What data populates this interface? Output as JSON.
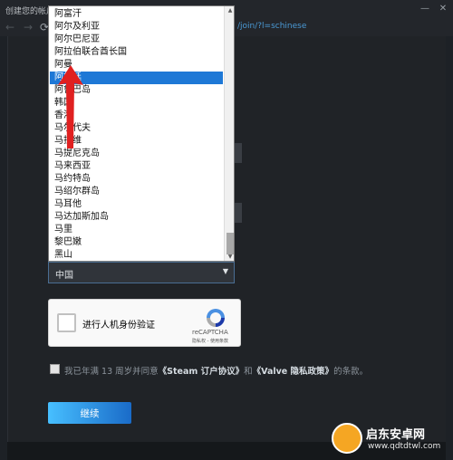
{
  "window": {
    "title": "创建您的帐户",
    "controls": [
      "minimize-icon",
      "close-icon"
    ]
  },
  "nav": {
    "back_icon": "arrow-left-icon",
    "forward_icon": "arrow-right-icon",
    "reload_icon": "reload-icon",
    "url": "/join/?l=schinese"
  },
  "country_dropdown": {
    "items": [
      "阿富汗",
      "阿尔及利亚",
      "阿尔巴尼亚",
      "阿拉伯联合酋长国",
      "阿曼",
      "阿根廷",
      "阿鲁巴岛",
      "韩国",
      "香港",
      "马尔代夫",
      "马拉维",
      "马提尼克岛",
      "马来西亚",
      "马约特岛",
      "马绍尔群岛",
      "马耳他",
      "马达加斯加岛",
      "马里",
      "黎巴嫩",
      "黑山"
    ],
    "highlighted": "阿根廷",
    "selected": "中国",
    "caret_icon": "chevron-down-icon"
  },
  "captcha": {
    "label": "进行人机身份验证",
    "brand": "reCAPTCHA",
    "links": "隐私权 - 使用条款",
    "logo_icon": "recaptcha-logo-icon"
  },
  "agreement": {
    "prefix": "我已年满 13 周岁并同意",
    "link1": "《Steam 订户协议》",
    "middle": "和",
    "link2": "《Valve 隐私政策》",
    "suffix": "的条款。"
  },
  "continue_button": "继续",
  "watermark": {
    "title": "启东安卓网",
    "url": "www.qdtdtwl.com",
    "logo_icon": "watermark-logo-icon"
  },
  "annotation": {
    "icon": "red-arrow-icon",
    "color": "#e02020"
  },
  "colors": {
    "highlight": "#1e78d6",
    "button_start": "#47bfff",
    "button_end": "#1a6bc8",
    "link": "#4a9ad6"
  }
}
